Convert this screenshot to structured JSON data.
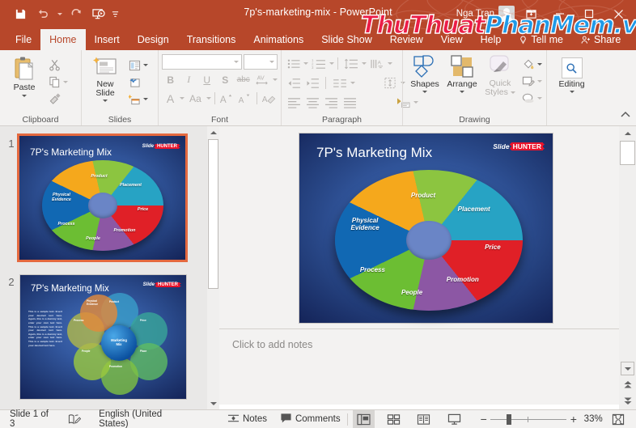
{
  "window": {
    "title": "7p's-marketing-mix  -  PowerPoint",
    "user_name": "Nga Tran",
    "brand_color": "#b7472a",
    "quick_access": [
      {
        "name": "save-button",
        "icon": "save-icon"
      },
      {
        "name": "undo-button",
        "icon": "undo-icon"
      },
      {
        "name": "redo-button",
        "icon": "redo-icon"
      },
      {
        "name": "start-presentation-button",
        "icon": "presentation-icon"
      },
      {
        "name": "customize-quick-access-button",
        "icon": "chevron-down-icon"
      }
    ],
    "controls": [
      {
        "name": "ribbon-display-options-button",
        "icon": "ribbon-options-icon"
      },
      {
        "name": "minimize-button",
        "icon": "minimize-icon"
      },
      {
        "name": "maximize-button",
        "icon": "maximize-icon"
      },
      {
        "name": "close-button",
        "icon": "close-icon"
      }
    ]
  },
  "watermark": {
    "part_a": "ThuThuat",
    "part_b": "PhanMem",
    "part_c": ".vn",
    "color_a": "#ec1c47",
    "color_b": "#1f9ae8"
  },
  "tabs": [
    {
      "label": "File",
      "active": false
    },
    {
      "label": "Home",
      "active": true
    },
    {
      "label": "Insert",
      "active": false
    },
    {
      "label": "Design",
      "active": false
    },
    {
      "label": "Transitions",
      "active": false
    },
    {
      "label": "Animations",
      "active": false
    },
    {
      "label": "Slide Show",
      "active": false
    },
    {
      "label": "Review",
      "active": false
    },
    {
      "label": "View",
      "active": false
    },
    {
      "label": "Help",
      "active": false
    },
    {
      "label": "Tell me",
      "active": false
    },
    {
      "label": "Share",
      "active": false
    }
  ],
  "ribbon": {
    "groups": [
      {
        "label": "Clipboard"
      },
      {
        "label": "Slides"
      },
      {
        "label": "Font"
      },
      {
        "label": "Paragraph"
      },
      {
        "label": "Drawing"
      }
    ],
    "clipboard": {
      "paste_label": "Paste",
      "cut_name": "cut-button",
      "copy_name": "copy-button",
      "format_painter_name": "format-painter-button"
    },
    "slides": {
      "new_slide_label": "New\nSlide",
      "layout_name": "slide-layout-button",
      "reset_name": "reset-slide-button",
      "section_name": "section-button"
    },
    "font": {
      "font_name_value": "",
      "font_name_placeholder": "",
      "font_size_value": "",
      "bold": "B",
      "italic": "I",
      "underline": "U",
      "strikethrough": "S",
      "text_shadow": "abc",
      "char_spacing": "AV",
      "font_color": "A",
      "change_case": "Aa",
      "grow_font": "A",
      "shrink_font": "A",
      "clear_formatting": "A"
    },
    "drawing": {
      "shapes_label": "Shapes",
      "arrange_label": "Arrange",
      "quick_styles_label": "Quick\nStyles",
      "shape_fill_name": "shape-fill-button",
      "shape_outline_name": "shape-outline-button",
      "shape_effects_name": "shape-effects-button"
    },
    "editing": {
      "label": "Editing"
    },
    "collapse_label": "collapse-ribbon-button"
  },
  "slide_deck": {
    "logo_slide": "Slide",
    "logo_hunter": "HUNTER",
    "thumbnails": [
      {
        "number": "1",
        "title": "7P's Marketing Mix",
        "selected": true
      },
      {
        "number": "2",
        "title": "7P's Marketing Mix",
        "selected": false
      }
    ]
  },
  "current_slide": {
    "title": "7P's Marketing Mix",
    "segments": [
      {
        "label": "Product",
        "color": "#8cc540"
      },
      {
        "label": "Placement",
        "color": "#27a3c4"
      },
      {
        "label": "Price",
        "color": "#e02027"
      },
      {
        "label": "Promotion",
        "color": "#8c57a4"
      },
      {
        "label": "People",
        "color": "#6cbe33"
      },
      {
        "label": "Process",
        "color": "#1168b3"
      },
      {
        "label": "Physical\nEvidence",
        "color": "#f5a81c"
      }
    ],
    "hub_color": "#6a85c6"
  },
  "slide2": {
    "center_label": "Marketing\nMix",
    "body_text": "This is a sample text. Insert your desired text here. Again, this is a dummy text, enter your own text here. This is a sample text. Insert your desired text here. Again, this is a dummy text, enter your own text here. This is a sample text. Insert your desired text here.",
    "bubbles": [
      {
        "label": "Product",
        "color": "#3a9ec9"
      },
      {
        "label": "Price",
        "color": "#38a598"
      },
      {
        "label": "Place",
        "color": "#5fbb62"
      },
      {
        "label": "Promotion",
        "color": "#7fc242"
      },
      {
        "label": "People",
        "color": "#9bc93e"
      },
      {
        "label": "Process",
        "color": "#b0b84a"
      },
      {
        "label": "Physical\nEvidence",
        "color": "#e08a3c"
      }
    ],
    "bullet": ".sample text"
  },
  "notes": {
    "placeholder": "Click to add notes"
  },
  "status": {
    "slide_counter": "Slide 1 of 3",
    "language": "English (United States)",
    "notes_label": "Notes",
    "comments_label": "Comments",
    "zoom_level": "33%",
    "accessibility_name": "accessibility-checker-button",
    "views": [
      {
        "name": "normal-view-button",
        "active": true
      },
      {
        "name": "slide-sorter-view-button",
        "active": false
      },
      {
        "name": "reading-view-button",
        "active": false
      },
      {
        "name": "slide-show-view-button",
        "active": false
      }
    ],
    "zoom_out_label": "−",
    "zoom_in_label": "+",
    "fit_slide_name": "fit-slide-to-window-button"
  }
}
